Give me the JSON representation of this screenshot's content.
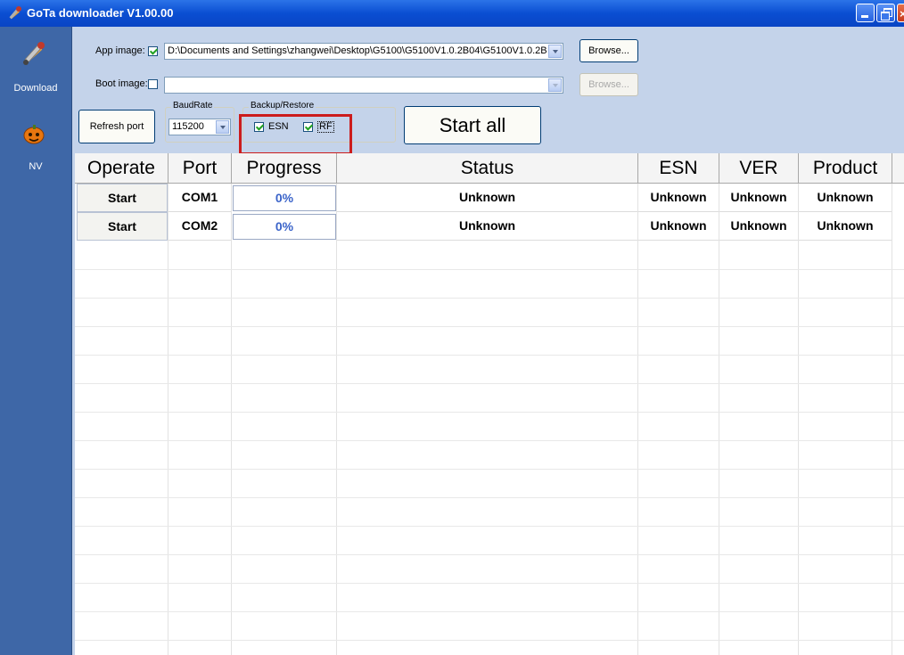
{
  "window": {
    "title": "GoTa downloader V1.00.00"
  },
  "sidebar": {
    "items": [
      {
        "label": "Download",
        "icon": "tools-icon"
      },
      {
        "label": "NV",
        "icon": "pumpkin-icon"
      }
    ]
  },
  "app_image": {
    "label": "App image:",
    "checked": true,
    "path": "D:\\Documents and Settings\\zhangwei\\Desktop\\G5100\\G5100V1.0.2B04\\G5100V1.0.2B",
    "browse": "Browse..."
  },
  "boot_image": {
    "label": "Boot image:",
    "checked": false,
    "path": "",
    "browse": "Browse..."
  },
  "refresh_label": "Refresh port",
  "baud": {
    "group_label": "BaudRate",
    "value": "115200"
  },
  "backup": {
    "group_label": "Backup/Restore",
    "esn_label": "ESN",
    "rf_label": "RF",
    "esn_checked": true,
    "rf_checked": true
  },
  "start_all_label": "Start all",
  "table": {
    "headers": [
      "Operate",
      "Port",
      "Progress",
      "Status",
      "ESN",
      "VER",
      "Product"
    ],
    "rows": [
      {
        "operate": "Start",
        "port": "COM1",
        "progress": "0%",
        "status": "Unknown",
        "esn": "Unknown",
        "ver": "Unknown",
        "product": "Unknown"
      },
      {
        "operate": "Start",
        "port": "COM2",
        "progress": "0%",
        "status": "Unknown",
        "esn": "Unknown",
        "ver": "Unknown",
        "product": "Unknown"
      }
    ]
  },
  "colors": {
    "titlebar": "#0a4ed2",
    "sidebar": "#3e67a7",
    "panel": "#c4d3ea",
    "highlight": "#cc1c1c",
    "progress_text": "#3a63c9"
  }
}
